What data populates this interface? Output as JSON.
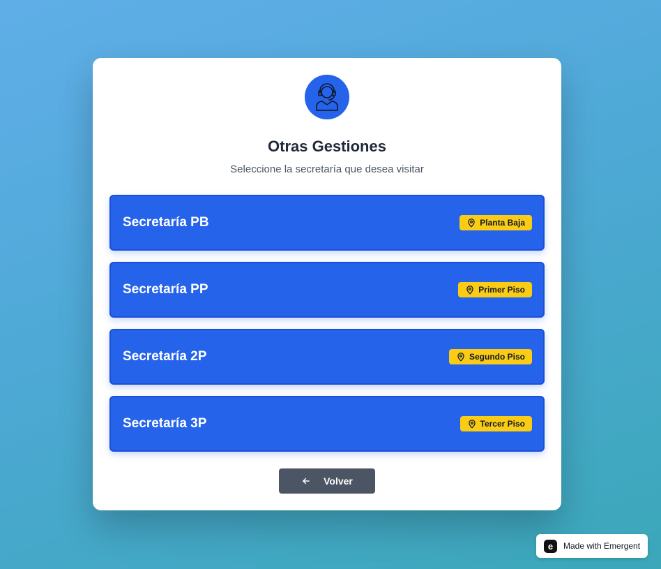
{
  "header": {
    "title": "Otras Gestiones",
    "subtitle": "Seleccione la secretaría que desea visitar",
    "icon": "support-agent-icon"
  },
  "options": [
    {
      "label": "Secretaría PB",
      "floor": "Planta Baja"
    },
    {
      "label": "Secretaría PP",
      "floor": "Primer Piso"
    },
    {
      "label": "Secretaría 2P",
      "floor": "Segundo Piso"
    },
    {
      "label": "Secretaría 3P",
      "floor": "Tercer Piso"
    }
  ],
  "back_button": {
    "label": "Volver",
    "icon": "arrow-left-icon"
  },
  "badge": {
    "text": "Made with Emergent",
    "logo_letter": "e"
  },
  "colors": {
    "primary": "#2563eb",
    "accent": "#facc15",
    "button_gray": "#4b5563"
  }
}
